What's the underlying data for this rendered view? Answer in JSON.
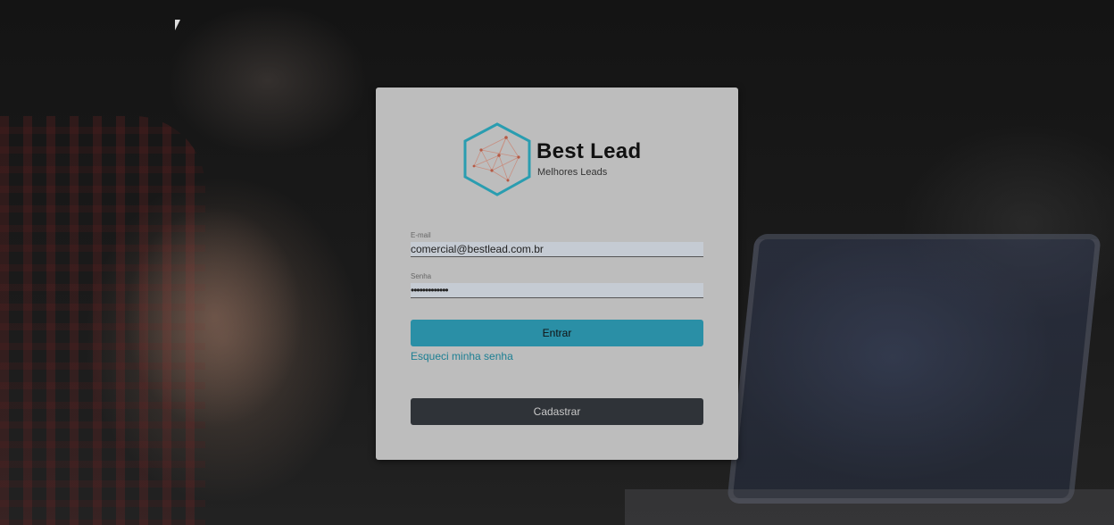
{
  "brand": {
    "name": "Best Lead",
    "tagline": "Melhores Leads",
    "logo_icon": "hexagon-network-icon",
    "accent_color": "#2a9db0"
  },
  "login": {
    "email_label": "E-mail",
    "email_value": "comercial@bestlead.com.br",
    "password_label": "Senha",
    "password_mask": "•••••••••••••",
    "submit_label": "Entrar",
    "forgot_label": "Esqueci minha senha",
    "register_label": "Cadastrar"
  },
  "colors": {
    "primary_button": "#2a8fa6",
    "secondary_button": "#2f3338",
    "link": "#1c7f93"
  }
}
